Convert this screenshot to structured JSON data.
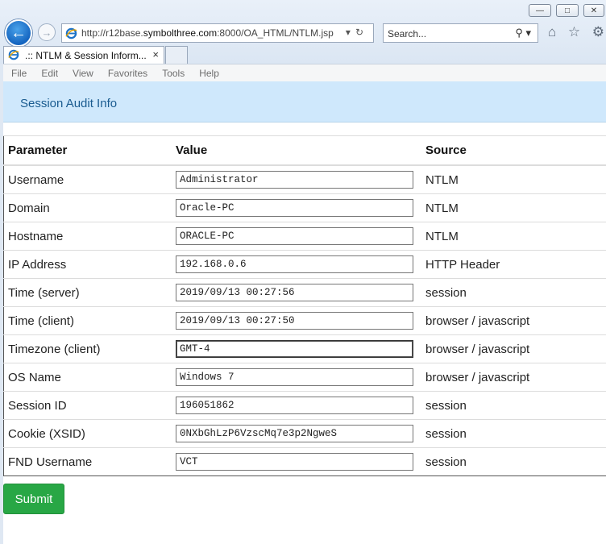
{
  "browser": {
    "url_prefix": "http://r12base.",
    "url_domain": "symbolthree.com",
    "url_rest": ":8000/OA_HTML/NTLM.jsp",
    "search_placeholder": "Search...",
    "tab_title": ".:: NTLM & Session Inform...",
    "menu": [
      "File",
      "Edit",
      "View",
      "Favorites",
      "Tools",
      "Help"
    ]
  },
  "page": {
    "title": "Session Audit Info",
    "columns": [
      "Parameter",
      "Value",
      "Source"
    ],
    "rows": [
      {
        "parameter": "Username",
        "value": "Administrator",
        "source": "NTLM"
      },
      {
        "parameter": "Domain",
        "value": "Oracle-PC",
        "source": "NTLM"
      },
      {
        "parameter": "Hostname",
        "value": "ORACLE-PC",
        "source": "NTLM"
      },
      {
        "parameter": "IP Address",
        "value": "192.168.0.6",
        "source": "HTTP Header"
      },
      {
        "parameter": "Time (server)",
        "value": "2019/09/13 00:27:56",
        "source": "session"
      },
      {
        "parameter": "Time (client)",
        "value": "2019/09/13 00:27:50",
        "source": "browser / javascript"
      },
      {
        "parameter": "Timezone (client)",
        "value": "GMT-4",
        "source": "browser / javascript"
      },
      {
        "parameter": "OS Name",
        "value": "Windows 7",
        "source": "browser / javascript"
      },
      {
        "parameter": "Session ID",
        "value": "196051862",
        "source": "session"
      },
      {
        "parameter": "Cookie (XSID)",
        "value": "0NXbGhLzP6VzscMq7e3p2NgweS",
        "source": "session"
      },
      {
        "parameter": "FND Username",
        "value": "VCT",
        "source": "session"
      }
    ],
    "submit_label": "Submit"
  },
  "colors": {
    "accent": "#28a745",
    "banner": "#cfe8fc",
    "banner_text": "#1a5b90"
  }
}
